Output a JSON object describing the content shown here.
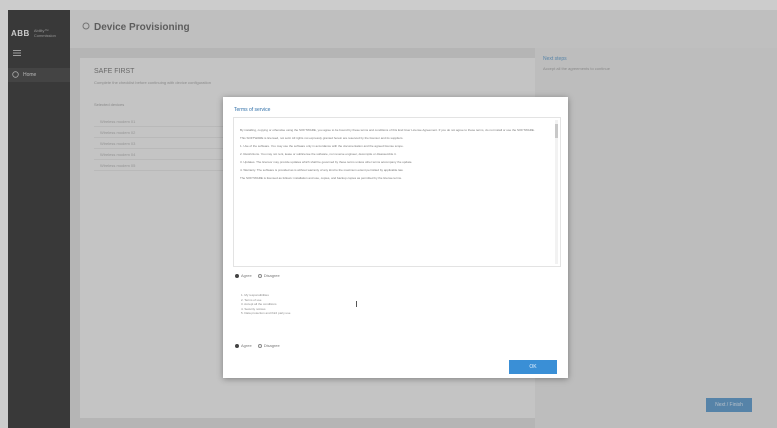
{
  "brand": {
    "logo": "ABB",
    "name_line1": "Ability™",
    "name_line2": "Commission"
  },
  "sidebar": {
    "nav_item": "Home"
  },
  "header": {
    "title": "Device Provisioning"
  },
  "panel": {
    "title": "SAFE FIRST",
    "subtitle": "Complete the checklist before continuing with device configuration",
    "section_label": "Selected devices",
    "rows": [
      "Wireless modem 01",
      "Wireless modem 02",
      "Wireless modem 03",
      "Wireless modem 04",
      "Wireless modem 05"
    ]
  },
  "right": {
    "heading": "Next steps",
    "subtext": "Accept all the agreements to continue"
  },
  "next_button": "Next / Finish",
  "modal": {
    "title": "Terms of service",
    "terms_paragraphs": [
      "By installing, copying or otherwise using the SOFTWARE, you agree to be bound by these terms and conditions of this End User License Agreement. If you do not agree to these terms, do not install or use the SOFTWARE.",
      "This SOFTWARE is licensed, not sold. All rights not expressly granted herein are reserved by the licensor and its suppliers.",
      "1. Use of the software. You may use the software only in accordance with the documentation and the agreed license scope.",
      "2. Restrictions. You may not rent, lease or sublicense the software, nor reverse engineer, decompile or disassemble it.",
      "3. Updates. The licensor may provide updates which shall be governed by these terms unless other terms accompany the update.",
      "4. Warranty. The software is provided as is without warranty of any kind to the maximum extent permitted by applicable law.",
      "The SOFTWARE is licensed as follows: installation and use, copies, and backup copies as permitted by the license terms."
    ],
    "agree_label": "Agree",
    "disagree_label": "Disagree",
    "list_items": [
      "1. My responsibilities",
      "2. Terms of use",
      "3. Accept all the conditions",
      "4. Security notices",
      "5. Data protection and third party use"
    ],
    "agree2_label": "Agree",
    "disagree2_label": "Disagree",
    "ok_button": "OK"
  }
}
